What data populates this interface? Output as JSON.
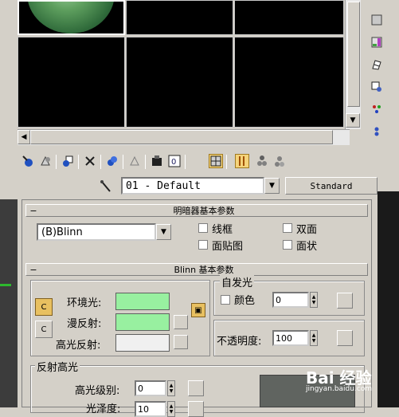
{
  "material_editor": {
    "material_name": "01 - Default",
    "type_button": "Standard",
    "shader_rollout": {
      "title": "明暗器基本参数",
      "shader_value": "(B)Blinn",
      "options": {
        "wire": "线框",
        "two_sided": "双面",
        "face_map": "面贴图",
        "faceted": "面状"
      }
    },
    "blinn_rollout": {
      "title": "Blinn 基本参数",
      "ambient_label": "环境光:",
      "diffuse_label": "漫反射:",
      "specular_label": "高光反射:",
      "ambient_color": "#98f0a0",
      "diffuse_color": "#98f0a0",
      "specular_color": "#f0f0f0",
      "self_illum": {
        "title": "自发光",
        "color_label": "颜色",
        "value": "0"
      },
      "opacity": {
        "label": "不透明度:",
        "value": "100"
      },
      "specular_highlights": {
        "title": "反射高光",
        "level_label": "高光级别:",
        "level_value": "0",
        "gloss_label": "光泽度:",
        "gloss_value": "10"
      }
    }
  },
  "icons": {
    "collapse": "−",
    "dropdown": "▼",
    "scroll_left": "◀",
    "scroll_up": "▲",
    "scroll_down": "▼",
    "lock": "🔒",
    "map_left_glyph": "C"
  },
  "watermark": {
    "logo": "Bai 经验",
    "url": "jingyan.baidu.com"
  }
}
